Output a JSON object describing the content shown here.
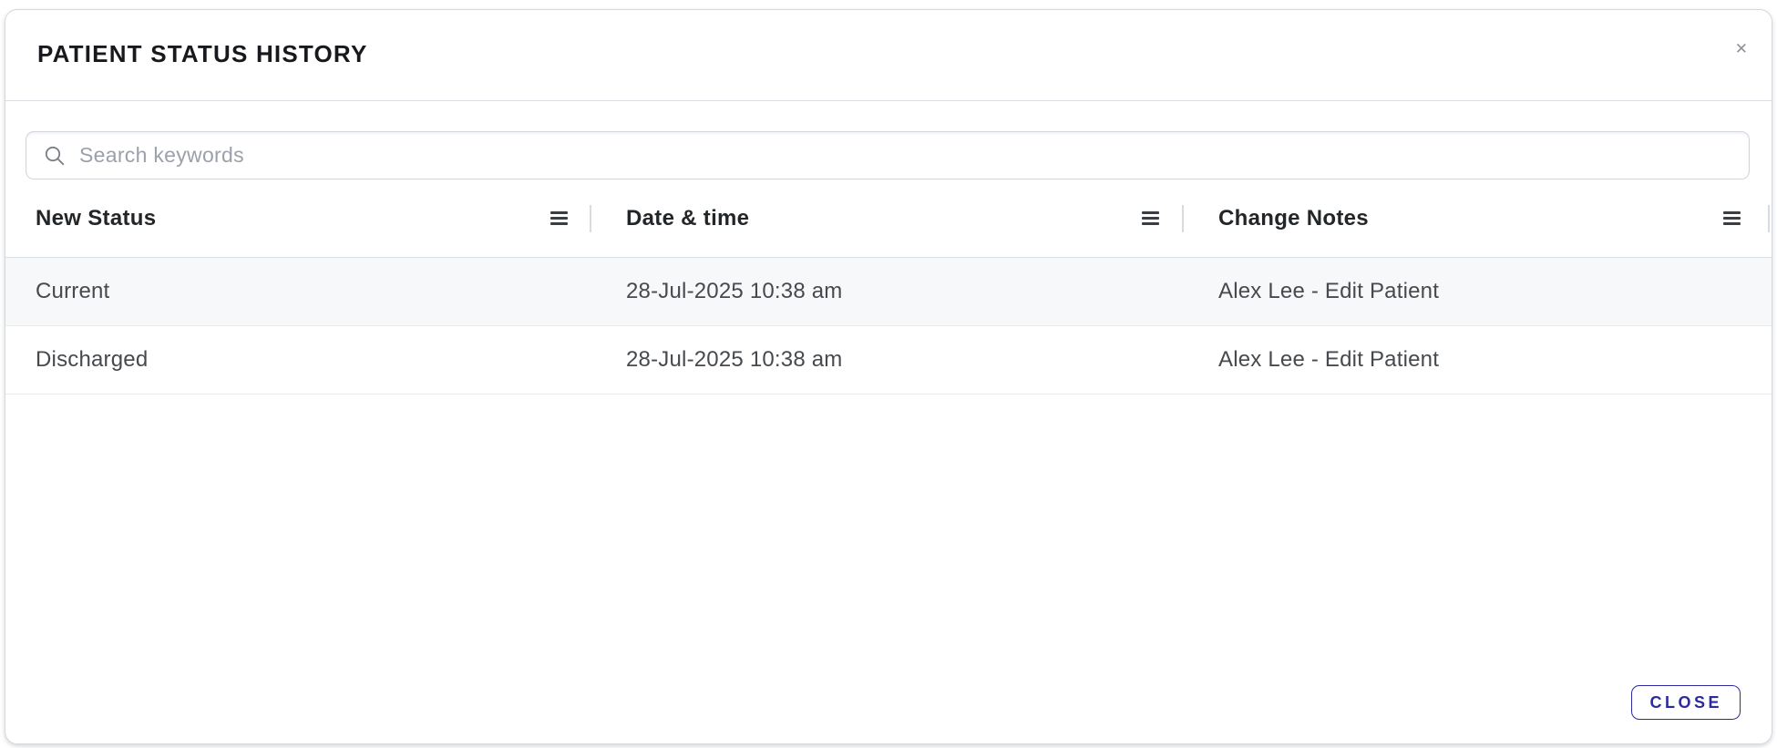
{
  "modal": {
    "title": "PATIENT STATUS HISTORY",
    "close_icon_glyph": "✕",
    "footer": {
      "close_button_label": "CLOSE"
    }
  },
  "search": {
    "placeholder": "Search keywords",
    "value": ""
  },
  "table": {
    "columns": [
      {
        "label": "New Status"
      },
      {
        "label": "Date & time"
      },
      {
        "label": "Change Notes"
      }
    ],
    "rows": [
      {
        "new_status": "Current",
        "date_time": "28-Jul-2025 10:38 am",
        "change_notes": "Alex Lee - Edit Patient"
      },
      {
        "new_status": "Discharged",
        "date_time": "28-Jul-2025 10:38 am",
        "change_notes": "Alex Lee - Edit Patient"
      }
    ]
  },
  "colors": {
    "accent": "#2d2aa0",
    "row_alt_bg": "#f7f8f9",
    "modal_border": "#d5d9de",
    "row_divider": "#e9ebee",
    "header_text": "#232629",
    "body_text": "#46494e",
    "placeholder_text": "#9ba1ab",
    "close_icon": "#8e9196"
  }
}
